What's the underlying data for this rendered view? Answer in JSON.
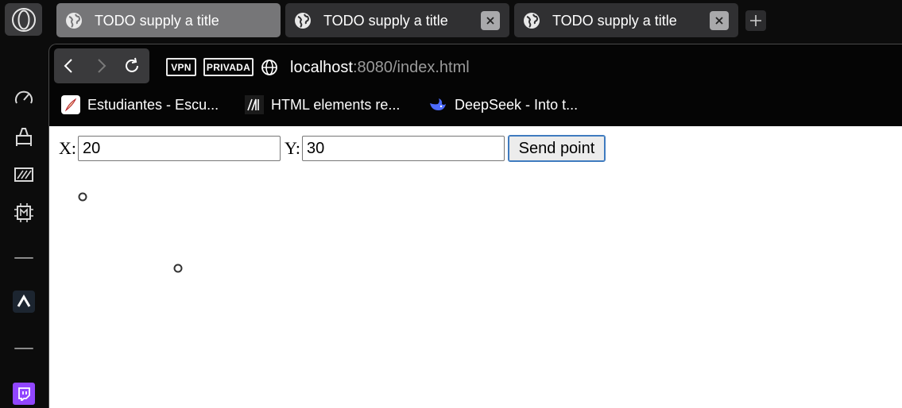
{
  "browser": {
    "tabs": [
      {
        "title": "TODO supply a title",
        "active": true
      },
      {
        "title": "TODO supply a title",
        "active": false
      },
      {
        "title": "TODO supply a title",
        "active": false
      }
    ],
    "badges": {
      "vpn": "VPN",
      "private": "PRIVADA"
    },
    "url": {
      "host": "localhost",
      "rest": ":8080/index.html"
    },
    "bookmarks": [
      {
        "label": "Estudiantes - Escu...",
        "icon": "feather-icon"
      },
      {
        "label": "HTML elements re...",
        "icon": "mdn-icon"
      },
      {
        "label": "DeepSeek - Into t...",
        "icon": "whale-icon"
      }
    ],
    "sidebar_icons": [
      "speed-dial-icon",
      "pinboard-icon",
      "easy-setup-icon",
      "ai-chip-icon",
      "aria-icon",
      "twitch-icon"
    ]
  },
  "page": {
    "x_label": "X:",
    "x_value": "20",
    "y_label": "Y:",
    "y_value": "30",
    "send_label": "Send point",
    "points_count_shown": 2
  },
  "colors": {
    "twitch": "#9146ff",
    "deepseek": "#4d6bfe",
    "active_tab": "#767678"
  }
}
